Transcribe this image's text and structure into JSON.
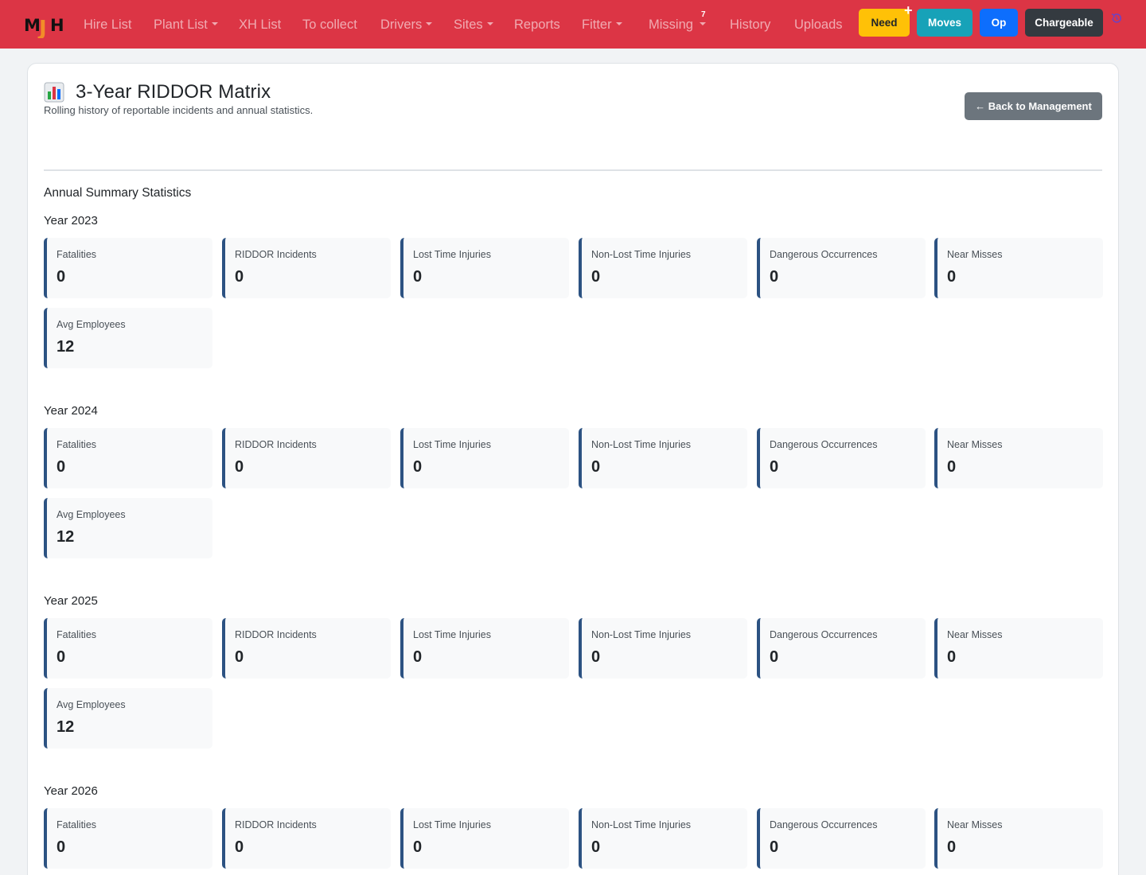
{
  "brand": {
    "logo_text": "MJH"
  },
  "nav": {
    "hire_list": "Hire List",
    "plant_list": "Plant List",
    "xh_list": "XH List",
    "to_collect": "To collect",
    "drivers": "Drivers",
    "sites": "Sites",
    "reports": "Reports",
    "fitter": "Fitter",
    "missing": "Missing",
    "missing_count": "7",
    "history": "History",
    "uploads": "Uploads"
  },
  "buttons": {
    "need": "Need",
    "need_plus": "+",
    "moves": "Moves",
    "op": "Op",
    "chargeable": "Chargeable"
  },
  "page": {
    "title": "3-Year RIDDOR Matrix",
    "subtitle": "Rolling history of reportable incidents and annual statistics.",
    "back_button": "← Back to Management",
    "section_title": "Annual Summary Statistics"
  },
  "years": [
    {
      "label": "Year 2023",
      "stats": [
        {
          "label": "Fatalities",
          "value": "0"
        },
        {
          "label": "RIDDOR Incidents",
          "value": "0"
        },
        {
          "label": "Lost Time Injuries",
          "value": "0"
        },
        {
          "label": "Non-Lost Time Injuries",
          "value": "0"
        },
        {
          "label": "Dangerous Occurrences",
          "value": "0"
        },
        {
          "label": "Near Misses",
          "value": "0"
        },
        {
          "label": "Avg Employees",
          "value": "12"
        }
      ]
    },
    {
      "label": "Year 2024",
      "stats": [
        {
          "label": "Fatalities",
          "value": "0"
        },
        {
          "label": "RIDDOR Incidents",
          "value": "0"
        },
        {
          "label": "Lost Time Injuries",
          "value": "0"
        },
        {
          "label": "Non-Lost Time Injuries",
          "value": "0"
        },
        {
          "label": "Dangerous Occurrences",
          "value": "0"
        },
        {
          "label": "Near Misses",
          "value": "0"
        },
        {
          "label": "Avg Employees",
          "value": "12"
        }
      ]
    },
    {
      "label": "Year 2025",
      "stats": [
        {
          "label": "Fatalities",
          "value": "0"
        },
        {
          "label": "RIDDOR Incidents",
          "value": "0"
        },
        {
          "label": "Lost Time Injuries",
          "value": "0"
        },
        {
          "label": "Non-Lost Time Injuries",
          "value": "0"
        },
        {
          "label": "Dangerous Occurrences",
          "value": "0"
        },
        {
          "label": "Near Misses",
          "value": "0"
        },
        {
          "label": "Avg Employees",
          "value": "12"
        }
      ]
    },
    {
      "label": "Year 2026",
      "stats": [
        {
          "label": "Fatalities",
          "value": "0"
        },
        {
          "label": "RIDDOR Incidents",
          "value": "0"
        },
        {
          "label": "Lost Time Injuries",
          "value": "0"
        },
        {
          "label": "Non-Lost Time Injuries",
          "value": "0"
        },
        {
          "label": "Dangerous Occurrences",
          "value": "0"
        },
        {
          "label": "Near Misses",
          "value": "0"
        }
      ]
    }
  ],
  "colors": {
    "navbar": "#dc3545",
    "accent_border": "#2c5282",
    "need": "#ffc107",
    "moves": "#17a2b8",
    "op": "#0d6efd",
    "chargeable": "#343a40"
  }
}
